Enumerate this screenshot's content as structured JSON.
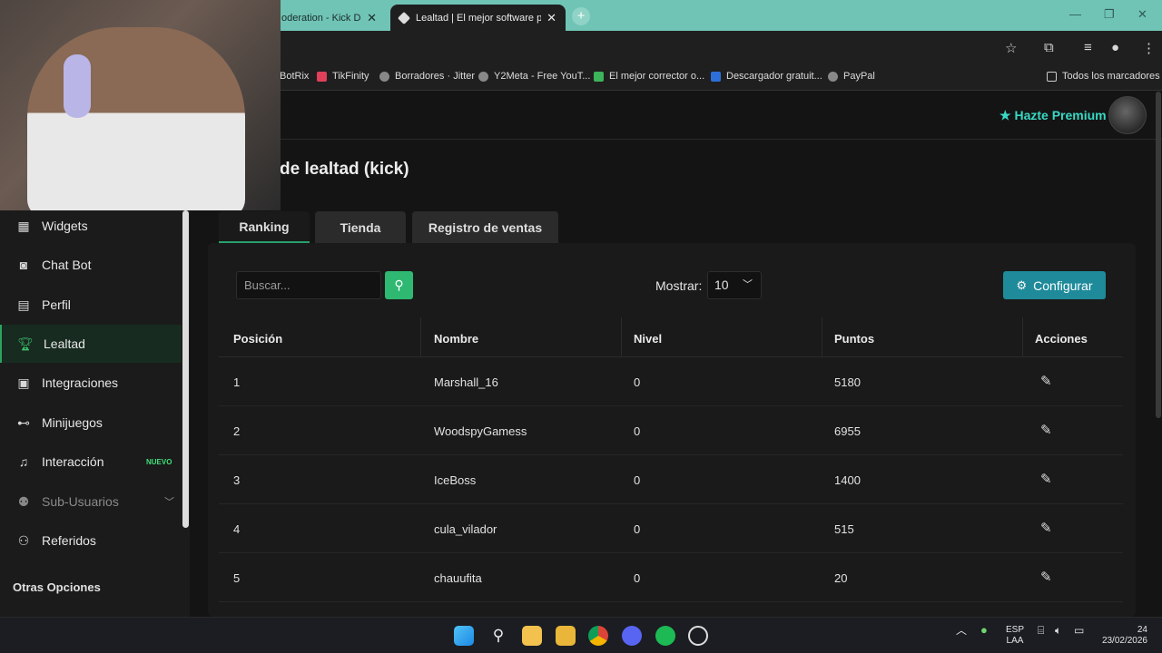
{
  "browser": {
    "tabs": [
      {
        "title": "oderation - Kick Da",
        "active": false
      },
      {
        "title": "Lealtad | El mejor software para",
        "active": true
      }
    ],
    "bookmarks": [
      "BotRix",
      "TikFinity",
      "Borradores · Jitter",
      "Y2Meta - Free YouT...",
      "El mejor corrector o...",
      "Descargador gratuit...",
      "PayPal"
    ],
    "all_bookmarks": "Todos los marcadores"
  },
  "header": {
    "premium_label": "Hazte Premium"
  },
  "page": {
    "title": "de lealtad (kick)"
  },
  "sidebar": {
    "items": [
      {
        "label": "Widgets",
        "icon": "grid-icon"
      },
      {
        "label": "Chat Bot",
        "icon": "robot-icon"
      },
      {
        "label": "Perfil",
        "icon": "id-card-icon"
      },
      {
        "label": "Lealtad",
        "icon": "trophy-icon",
        "active": true
      },
      {
        "label": "Integraciones",
        "icon": "puzzle-icon"
      },
      {
        "label": "Minijuegos",
        "icon": "gamepad-icon"
      },
      {
        "label": "Interacción",
        "icon": "music-icon",
        "badge": "NUEVO"
      },
      {
        "label": "Sub-Usuarios",
        "icon": "users-icon",
        "disabled": true
      },
      {
        "label": "Referidos",
        "icon": "user-group-icon"
      }
    ],
    "section_other": "Otras Opciones"
  },
  "tabs": [
    "Ranking",
    "Tienda",
    "Registro de ventas"
  ],
  "controls": {
    "search_placeholder": "Buscar...",
    "show_label": "Mostrar:",
    "show_value": "10",
    "config_label": "Configurar"
  },
  "table": {
    "headers": [
      "Posición",
      "Nombre",
      "Nivel",
      "Puntos",
      "Acciones"
    ],
    "rows": [
      {
        "pos": "1",
        "name": "Marshall_16",
        "level": "0",
        "points": "5180"
      },
      {
        "pos": "2",
        "name": "WoodspyGamess",
        "level": "0",
        "points": "6955"
      },
      {
        "pos": "3",
        "name": "IceBoss",
        "level": "0",
        "points": "1400"
      },
      {
        "pos": "4",
        "name": "cula_vilador",
        "level": "0",
        "points": "515"
      },
      {
        "pos": "5",
        "name": "chauufita",
        "level": "0",
        "points": "20"
      }
    ]
  },
  "taskbar": {
    "lang": "ESP",
    "layout": "LAA",
    "time": "24",
    "date": "23/02/2026"
  },
  "colors": {
    "accent_green": "#2eb872",
    "premium_teal": "#38d9c4",
    "config_blue": "#1e8a9a",
    "tabbar": "#6fc4b5"
  }
}
